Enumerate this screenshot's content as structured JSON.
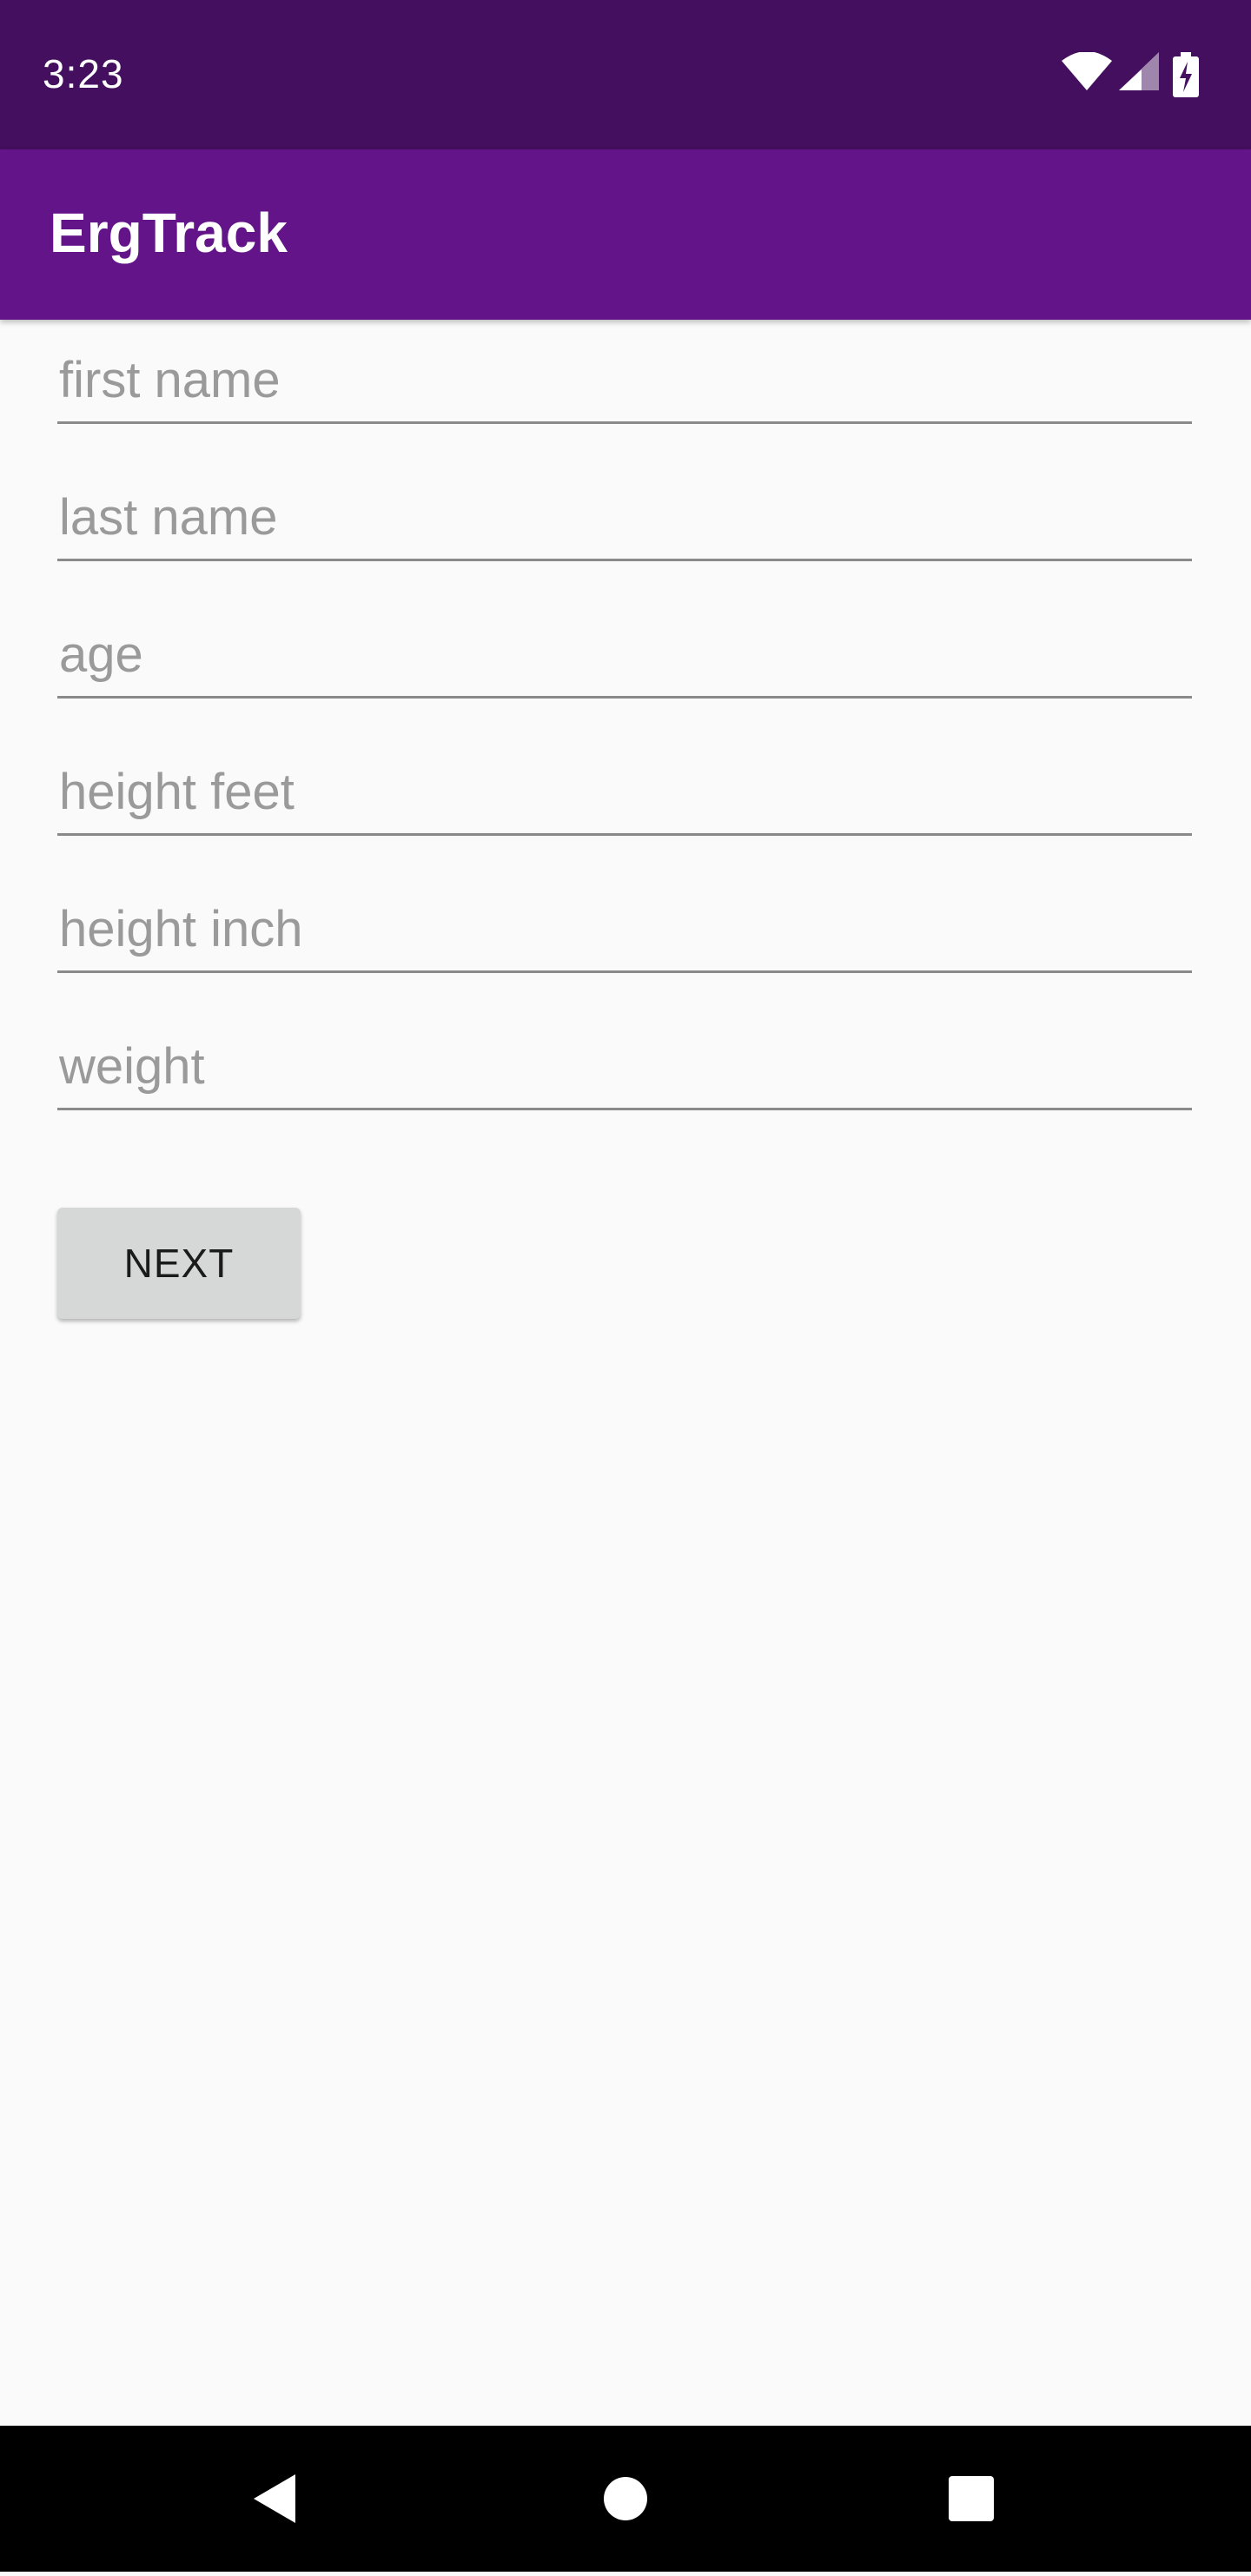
{
  "status_bar": {
    "time": "3:23",
    "icons": [
      "wifi-icon",
      "cell-signal-icon",
      "battery-charging-icon"
    ],
    "background": "#430f5e"
  },
  "app_bar": {
    "title": "ErgTrack",
    "background": "#641489"
  },
  "form": {
    "fields": [
      {
        "placeholder": "first name",
        "value": ""
      },
      {
        "placeholder": "last name",
        "value": ""
      },
      {
        "placeholder": "age",
        "value": ""
      },
      {
        "placeholder": "height feet",
        "value": ""
      },
      {
        "placeholder": "height inch",
        "value": ""
      },
      {
        "placeholder": "weight",
        "value": ""
      }
    ],
    "next_label": "NEXT"
  },
  "nav_bar": {
    "buttons": [
      "back-icon",
      "home-icon",
      "recents-icon"
    ]
  }
}
